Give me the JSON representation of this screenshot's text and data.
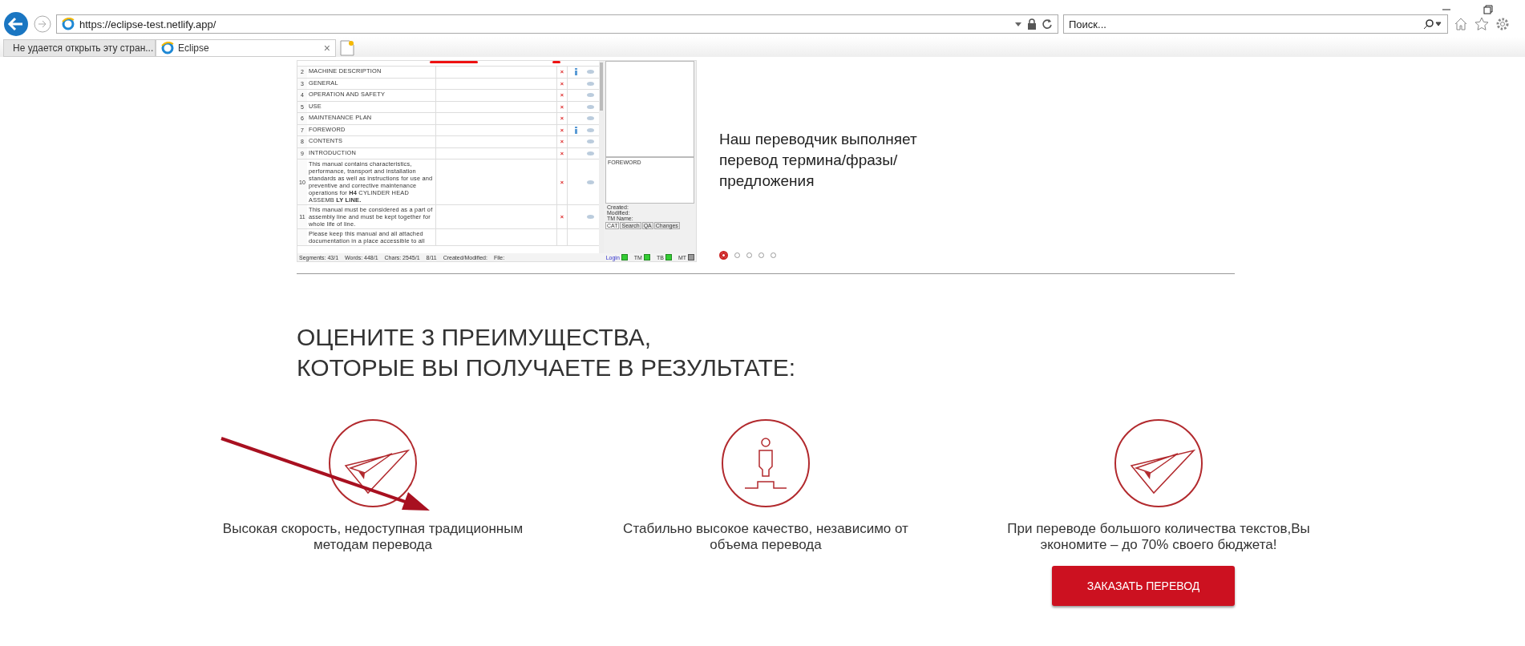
{
  "browser": {
    "url": "https://eclipse-test.netlify.app/",
    "search": {
      "placeholder": "Поиск..."
    },
    "tabs": [
      {
        "label": "Не удается открыть эту стран...",
        "selected": false
      },
      {
        "label": "Eclipse",
        "selected": true,
        "close": "×"
      }
    ]
  },
  "slide": {
    "editor": {
      "rows": [
        {
          "n": "2",
          "text": "MACHINE DESCRIPTION",
          "mark": "×",
          "info": true
        },
        {
          "n": "3",
          "text": "GENERAL",
          "mark": "×",
          "info": false
        },
        {
          "n": "4",
          "text": "OPERATION AND SAFETY",
          "mark": "×",
          "info": false
        },
        {
          "n": "5",
          "text": "USE",
          "mark": "×",
          "info": false
        },
        {
          "n": "6",
          "text": "MAINTENANCE PLAN",
          "mark": "×",
          "info": false
        },
        {
          "n": "7",
          "text": "FOREWORD",
          "mark": "×",
          "info": true
        },
        {
          "n": "8",
          "text": "CONTENTS",
          "mark": "×",
          "info": false
        },
        {
          "n": "9",
          "text": "INTRODUCTION",
          "mark": "×",
          "info": false
        },
        {
          "n": "10",
          "text": "This manual contains characteristics, performance, transport and installation standards as well as instructions for use and preventive and corrective maintenance operations for **H4** CYLINDER HEAD ASSEMB **LY LINE.**",
          "mark": "×",
          "info": false
        },
        {
          "n": "11",
          "text": "This manual must be considered as a part of assembly line and must be kept together for whole life of line.",
          "mark": "×",
          "info": false
        },
        {
          "n": "",
          "text": "Please keep this manual and all attached documentation in a place accessible to all",
          "mark": "",
          "info": false
        }
      ],
      "preview": "FOREWORD",
      "meta": [
        "Created:",
        "Modified:",
        "TM Name:"
      ],
      "panel_tabs": [
        {
          "label": "CAT",
          "selected": true
        },
        {
          "label": "Search",
          "selected": false
        },
        {
          "label": "QA",
          "selected": false
        },
        {
          "label": "Changes",
          "selected": false
        }
      ],
      "status": [
        "Segments: 43/1",
        "Words: 448/1",
        "Chars: 2545/1",
        "8/11",
        "Created/Modified:",
        "File:"
      ],
      "indicators": [
        {
          "label": "Login",
          "on": true
        },
        {
          "label": "TM",
          "on": true
        },
        {
          "label": "TB",
          "on": true
        },
        {
          "label": "MT",
          "on": false
        }
      ]
    },
    "caption": "Наш переводчик выполняет перевод термина/фразы/предложения",
    "dots": [
      {
        "selected": true
      },
      {
        "selected": false
      },
      {
        "selected": false
      },
      {
        "selected": false
      },
      {
        "selected": false
      }
    ]
  },
  "benefits": {
    "title": "ОЦЕНИТЕ 3 ПРЕИМУЩЕСТВА,\nКОТОРЫЕ ВЫ ПОЛУЧАЕТЕ В РЕЗУЛЬТАТЕ:",
    "items": [
      {
        "kind": "plane",
        "text": "Высокая скорость, недоступная традиционным методам перевода"
      },
      {
        "kind": "person",
        "text": "Стабильно высокое качество, независимо от объема перевода"
      },
      {
        "kind": "plane",
        "text": "При переводе большого количества текстов,Вы экономите – до 70% своего бюджета!"
      }
    ]
  },
  "order_button": "ЗАКАЗАТЬ ПЕРЕВОД"
}
